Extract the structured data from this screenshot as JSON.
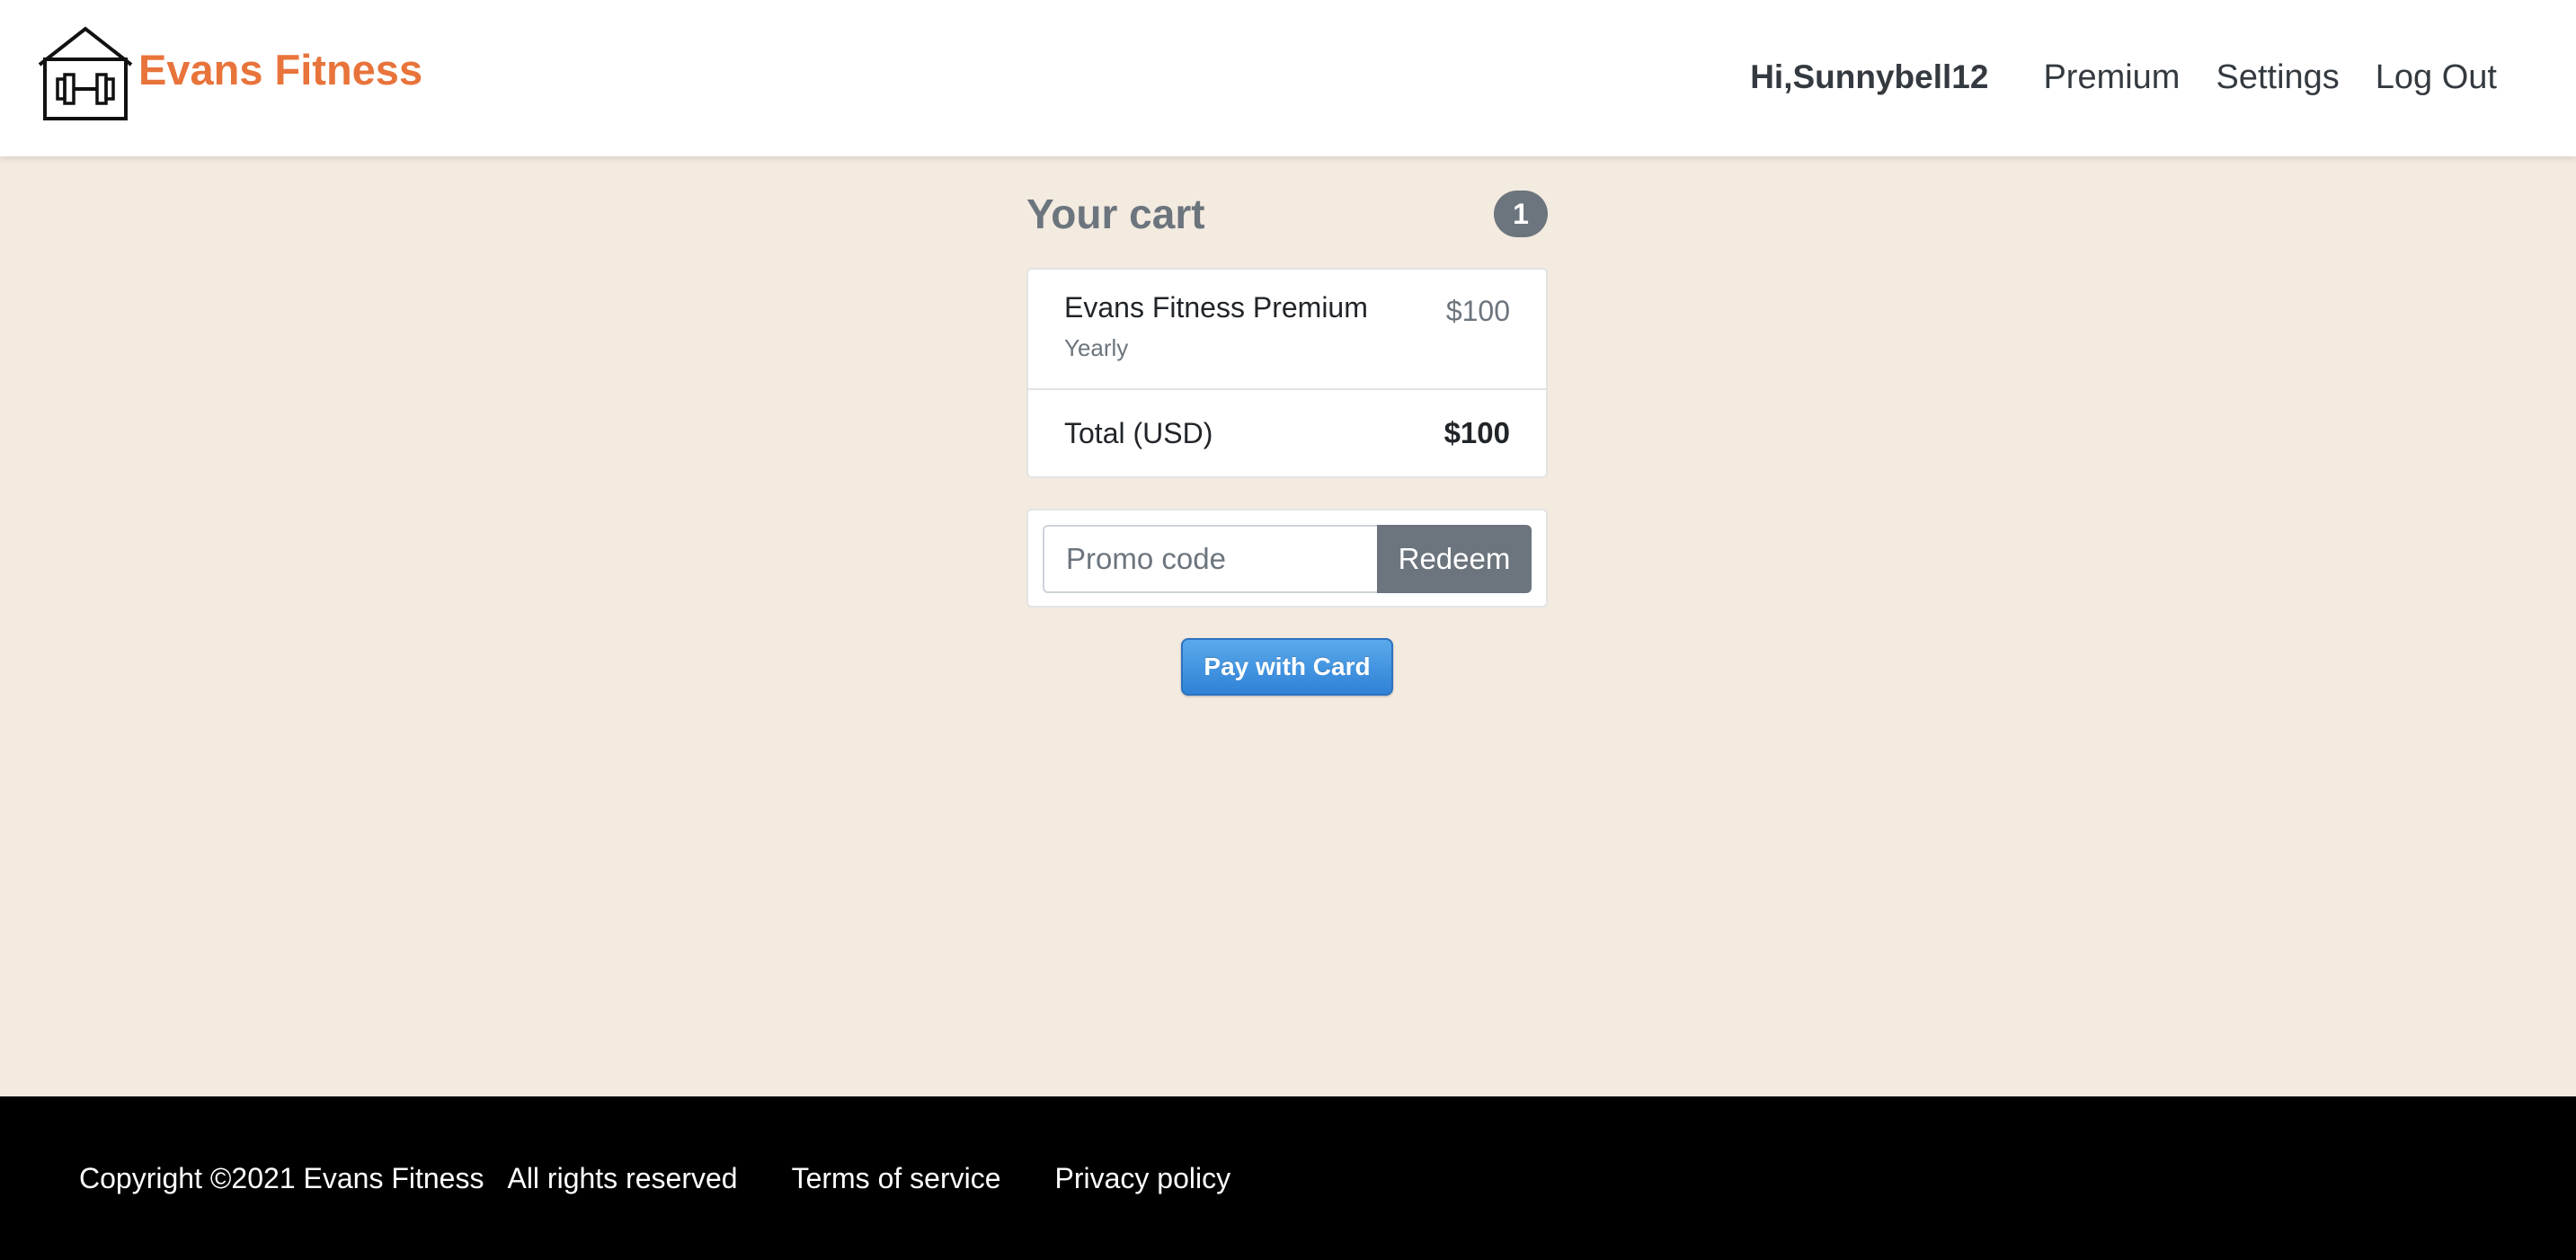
{
  "navbar": {
    "brand_name": "Evans Fitness",
    "brand_icon": "home-gym-dumbbell-icon",
    "greeting": "Hi,Sunnybell12",
    "links": [
      "Premium",
      "Settings",
      "Log Out"
    ]
  },
  "cart": {
    "title": "Your cart",
    "count": "1",
    "items": [
      {
        "name": "Evans Fitness Premium",
        "period": "Yearly",
        "price": "$100"
      }
    ],
    "total_label": "Total (USD)",
    "total_value": "$100"
  },
  "promo": {
    "placeholder": "Promo code",
    "value": "",
    "redeem_label": "Redeem"
  },
  "payment": {
    "pay_label": "Pay with Card"
  },
  "footer": {
    "copyright": "Copyright ©2021 Evans Fitness",
    "rights": "All rights reserved",
    "links": [
      "Terms of service",
      "Privacy policy"
    ]
  },
  "colors": {
    "brand": "#e8743b",
    "background": "#f3eae0",
    "badge": "#6c757d",
    "pay_button": "#3b8fe0",
    "footer": "#000000"
  }
}
